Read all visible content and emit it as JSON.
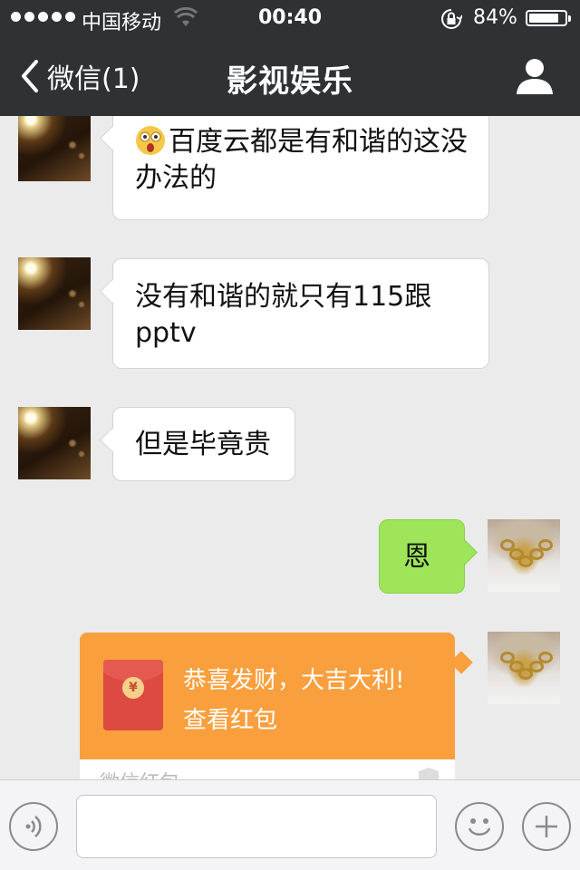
{
  "status_bar": {
    "carrier": "中国移动",
    "time": "00:40",
    "battery_pct": "84%",
    "battery_level": 0.84,
    "signal_bars": 5,
    "icons": [
      "wifi-icon",
      "rotation-lock-icon",
      "battery-icon"
    ]
  },
  "nav": {
    "back_label": "微信(1)",
    "title": "影视娱乐",
    "icons": [
      "chevron-left-icon",
      "person-icon"
    ]
  },
  "messages": [
    {
      "side": "left",
      "avatar": "street-light-avatar",
      "emoji": "astonished-emoji-icon",
      "text": "百度云都是有和谐的这没办法的"
    },
    {
      "side": "left",
      "avatar": "street-light-avatar",
      "text": "没有和谐的就只有115跟pptv"
    },
    {
      "side": "left",
      "avatar": "street-light-avatar",
      "text": "但是毕竟贵"
    },
    {
      "side": "right",
      "avatar": "gold-chain-avatar",
      "text": "恩"
    }
  ],
  "red_packet": {
    "title": "恭喜发财，大吉大利!",
    "subtitle": "查看红包",
    "footer": "微信红包",
    "coin_symbol": "¥",
    "colors": {
      "card": "#f99f3d",
      "envelope": "#dd4a42"
    }
  },
  "input_bar": {
    "icons": [
      "voice-icon",
      "emoji-icon",
      "plus-icon"
    ],
    "input_value": ""
  },
  "colors": {
    "nav_bg": "#2e3235",
    "chat_bg": "#ebebeb",
    "sent_bubble": "#9ee55a"
  }
}
